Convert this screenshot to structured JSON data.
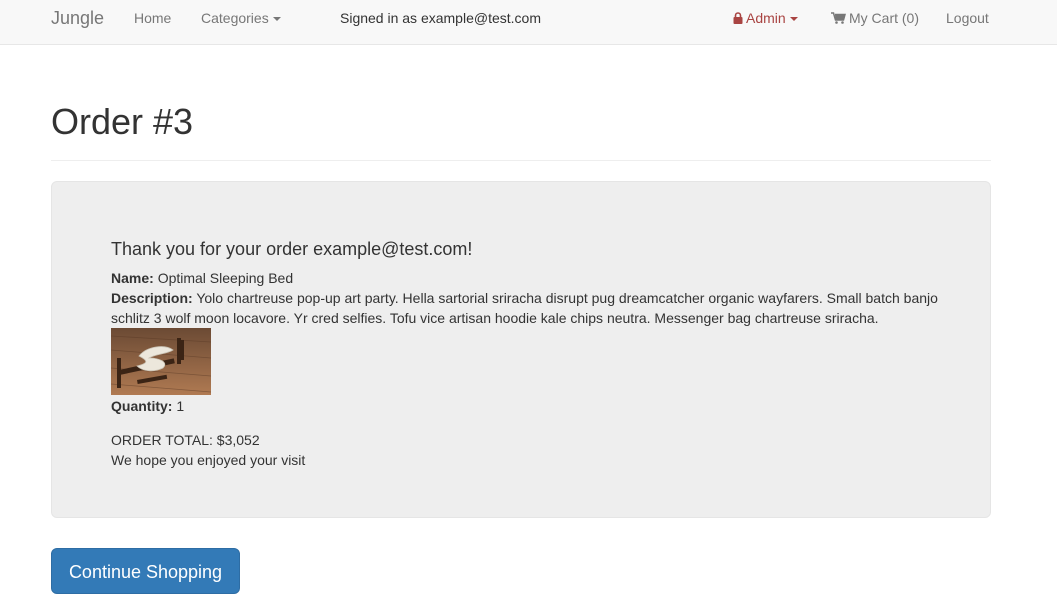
{
  "navbar": {
    "brand": "Jungle",
    "home": "Home",
    "categories": "Categories",
    "signed_in": "Signed in as example@test.com",
    "admin": "Admin",
    "cart": "My Cart (0)",
    "logout": "Logout",
    "admin_color": "#a94442"
  },
  "page": {
    "title": "Order #3"
  },
  "order": {
    "thanks": "Thank you for your order example@test.com!",
    "name_label": "Name:",
    "name": "Optimal Sleeping Bed",
    "description_label": "Description:",
    "description": "Yolo chartreuse pop-up art party. Hella sartorial sriracha disrupt pug dreamcatcher organic wayfarers. Small batch banjo schlitz 3 wolf moon locavore. Yr cred selfies. Tofu vice artisan hoodie kale chips neutra. Messenger bag chartreuse sriracha.",
    "quantity_label": "Quantity:",
    "quantity": "1",
    "total": "ORDER TOTAL: $3,052",
    "visit_message": "We hope you enjoyed your visit"
  },
  "actions": {
    "continue_label": "Continue Shopping",
    "primary_color": "#337ab7"
  }
}
